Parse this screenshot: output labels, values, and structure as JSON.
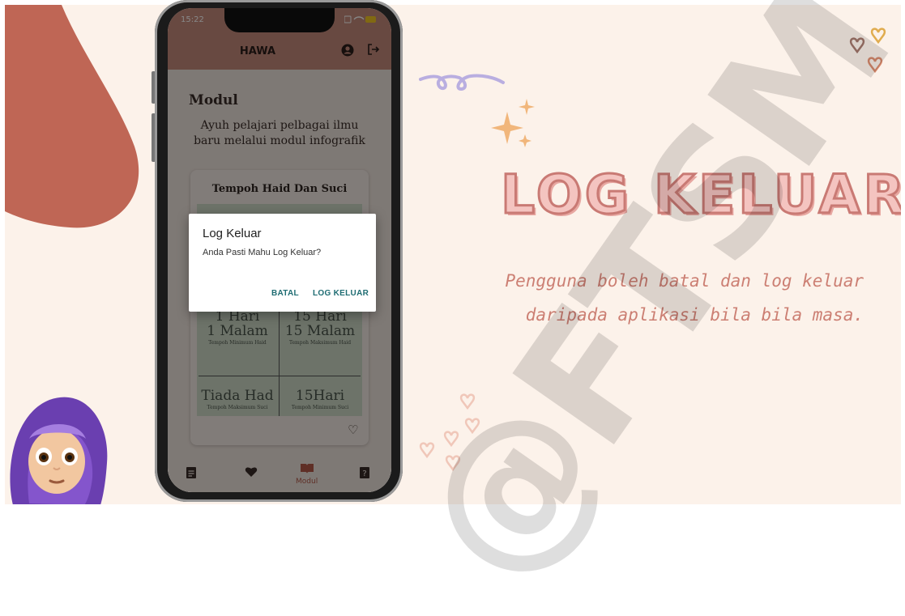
{
  "slide": {
    "headline": "LOG KELUAR",
    "description_line1": "Pengguna boleh batal dan log keluar",
    "description_line2": "daripada aplikasi bila bila masa.",
    "watermark": "@FTSM",
    "colors": {
      "background": "#fcf2ea",
      "blob": "#bf6655",
      "accent_text": "#cc7f73",
      "title_fill": "#f4c4c0",
      "title_stroke": "#c97a74"
    }
  },
  "phone": {
    "status_time": "15:22",
    "app_title": "HAWA",
    "header_icons": [
      "account-icon",
      "logout-icon"
    ],
    "page_title": "Modul",
    "page_subtitle_line1": "Ayuh pelajari pelbagai ilmu",
    "page_subtitle_line2": "baru melalui modul infografik",
    "card": {
      "title": "Tempoh Haid Dan Suci",
      "cells": [
        {
          "big1": "1 Hari",
          "big2": "1 Malam",
          "caption": "Tempoh Minimum Haid"
        },
        {
          "big1": "15 Hari",
          "big2": "15 Malam",
          "caption": "Tempoh Maksimum Haid"
        },
        {
          "big1": "Tiada Had",
          "big2": "",
          "caption": "Tempoh Maksimum Suci"
        },
        {
          "big1": "15Hari",
          "big2": "",
          "caption": "Tempoh Minimum Suci"
        }
      ]
    },
    "bottom_nav": [
      {
        "icon": "document-icon",
        "label": ""
      },
      {
        "icon": "heart-icon",
        "label": ""
      },
      {
        "icon": "book-icon",
        "label": "Modul"
      },
      {
        "icon": "help-icon",
        "label": ""
      }
    ],
    "dialog": {
      "title": "Log Keluar",
      "message": "Anda Pasti Mahu Log Keluar?",
      "cancel_label": "BATAL",
      "confirm_label": "LOG KELUAR"
    }
  }
}
